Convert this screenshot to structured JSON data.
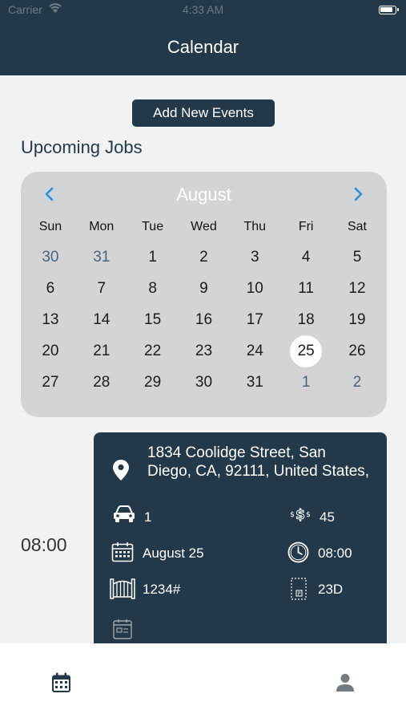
{
  "status_bar": {
    "carrier": "Carrier",
    "time": "4:33 AM"
  },
  "header": {
    "title": "Calendar"
  },
  "actions": {
    "add_events_label": "Add New Events"
  },
  "section": {
    "title": "Upcoming Jobs"
  },
  "calendar": {
    "month": "August",
    "weekdays": [
      "Sun",
      "Mon",
      "Tue",
      "Wed",
      "Thu",
      "Fri",
      "Sat"
    ],
    "days": [
      {
        "d": "30",
        "muted": true
      },
      {
        "d": "31",
        "muted": true
      },
      {
        "d": "1"
      },
      {
        "d": "2"
      },
      {
        "d": "3"
      },
      {
        "d": "4"
      },
      {
        "d": "5"
      },
      {
        "d": "6"
      },
      {
        "d": "7"
      },
      {
        "d": "8"
      },
      {
        "d": "9"
      },
      {
        "d": "10"
      },
      {
        "d": "11"
      },
      {
        "d": "12"
      },
      {
        "d": "13"
      },
      {
        "d": "14"
      },
      {
        "d": "15"
      },
      {
        "d": "16"
      },
      {
        "d": "17"
      },
      {
        "d": "18"
      },
      {
        "d": "19"
      },
      {
        "d": "20"
      },
      {
        "d": "21"
      },
      {
        "d": "22"
      },
      {
        "d": "23"
      },
      {
        "d": "24"
      },
      {
        "d": "25",
        "selected": true
      },
      {
        "d": "26"
      },
      {
        "d": "27"
      },
      {
        "d": "28"
      },
      {
        "d": "29"
      },
      {
        "d": "30"
      },
      {
        "d": "31"
      },
      {
        "d": "1",
        "muted": true
      },
      {
        "d": "2",
        "muted": true
      }
    ]
  },
  "job": {
    "time": "08:00",
    "address": "1834 Coolidge Street, San Diego, CA, 92111, United States,",
    "vehicles": "1",
    "price": "45",
    "date": "August 25",
    "start_time": "08:00",
    "gate_code": "1234#",
    "unit": "23D"
  },
  "colors": {
    "primary": "#23394a",
    "accent": "#2b8fd6",
    "calendar_bg": "#d3d4d6"
  }
}
